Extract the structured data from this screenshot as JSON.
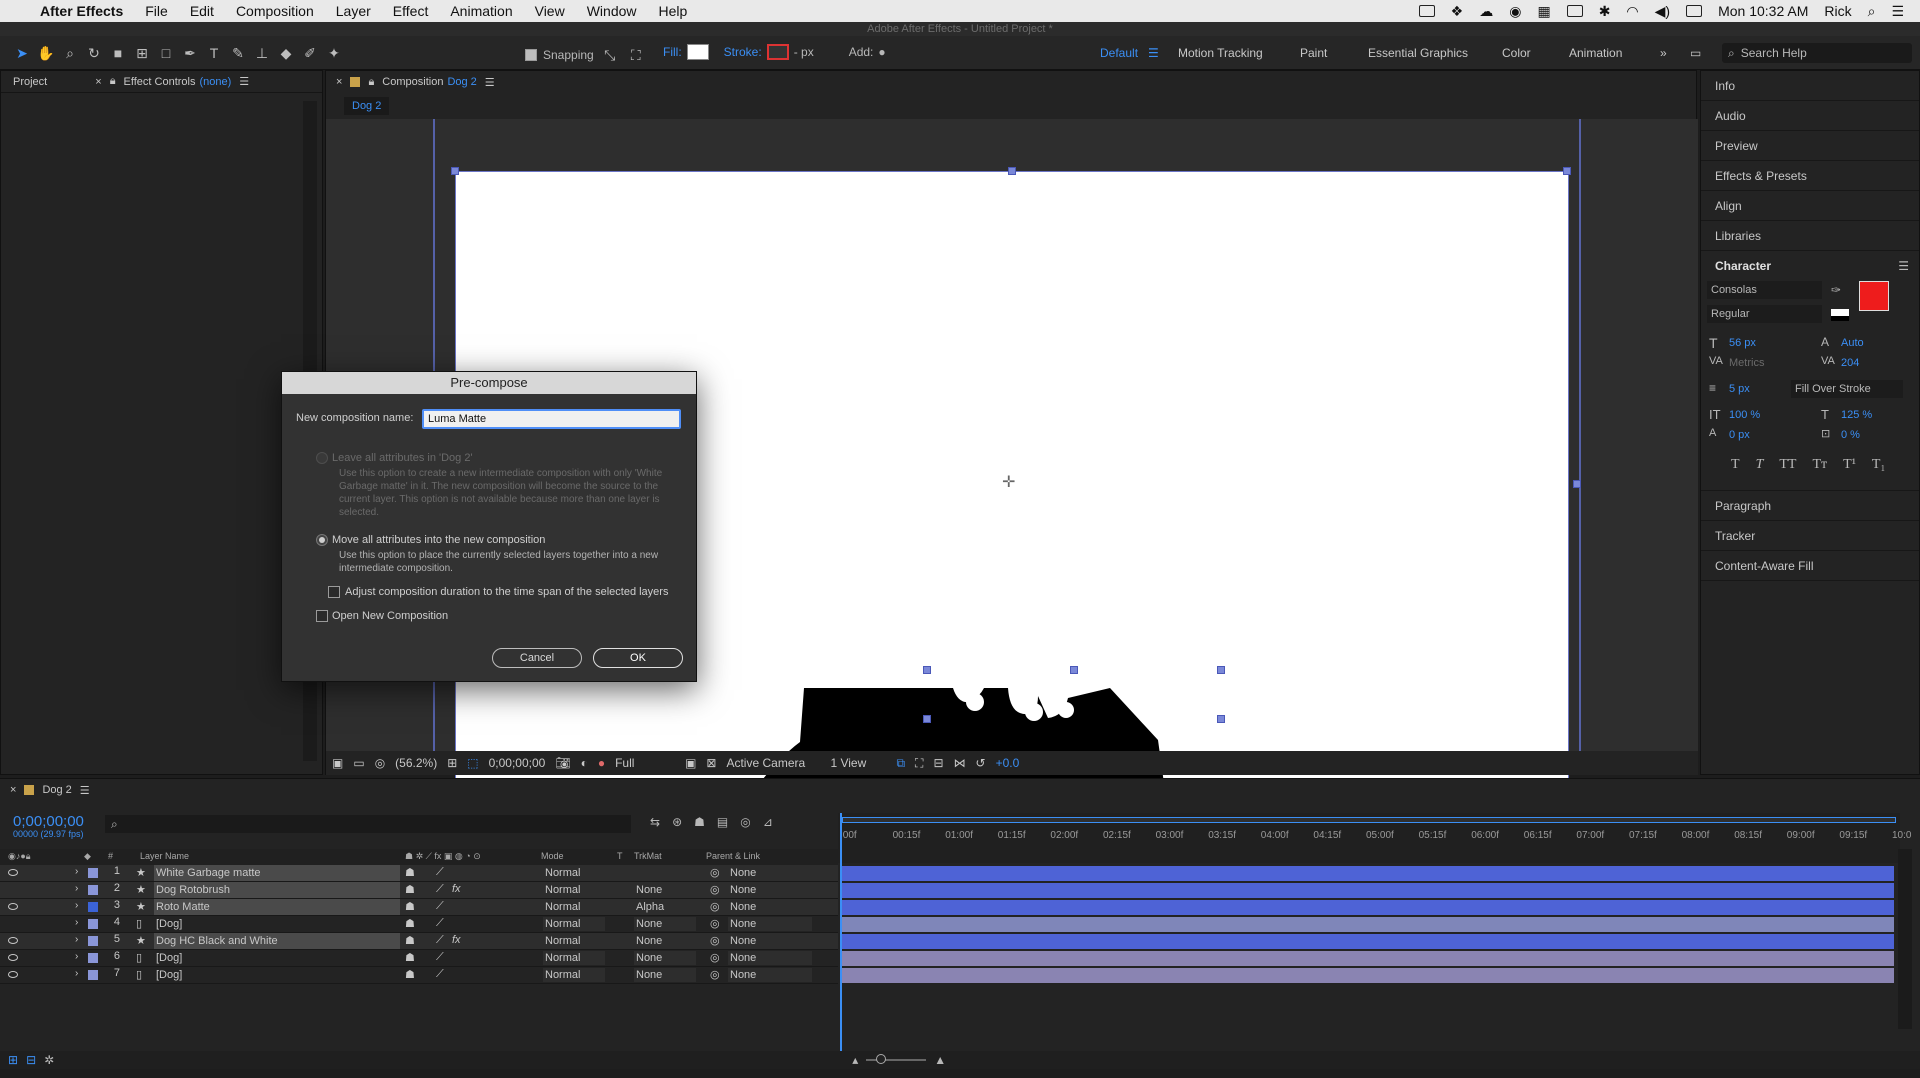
{
  "menubar": {
    "app": "After Effects",
    "items": [
      "File",
      "Edit",
      "Composition",
      "Layer",
      "Effect",
      "Animation",
      "View",
      "Window",
      "Help"
    ],
    "clock": "Mon 10:32 AM",
    "user": "Rick"
  },
  "window_title": "Adobe After Effects - Untitled Project *",
  "toolbar": {
    "snapping": "Snapping",
    "fill": "Fill:",
    "stroke": "Stroke:",
    "stroke_px": "- px",
    "add": "Add:",
    "workspaces": [
      "Default",
      "Motion Tracking",
      "Paint",
      "Essential Graphics",
      "Color",
      "Animation"
    ],
    "search_help": "Search Help"
  },
  "left_panel": {
    "tab_project": "Project",
    "tab_effect_controls": "Effect Controls",
    "effect_controls_target": "(none)"
  },
  "comp_panel": {
    "tab_label": "Composition",
    "comp_name": "Dog 2",
    "sub_tab": "Dog 2",
    "zoom": "(56.2%)",
    "timecode": "0;00;00;00",
    "resolution": "Full",
    "camera": "Active Camera",
    "views": "1 View",
    "exposure": "+0.0"
  },
  "right_panel": {
    "items": [
      "Info",
      "Audio",
      "Preview",
      "Effects & Presets",
      "Align",
      "Libraries"
    ],
    "character": {
      "title": "Character",
      "font": "Consolas",
      "style": "Regular",
      "size": "56 px",
      "leading": "Auto",
      "kerning": "Metrics",
      "tracking": "204",
      "stroke_width": "5 px",
      "stroke_mode": "Fill Over Stroke",
      "vscale": "100 %",
      "hscale": "125 %",
      "baseline": "0 px",
      "tsume": "0 %",
      "fill_color": "#ee1c1c"
    },
    "after": [
      "Paragraph",
      "Tracker",
      "Content-Aware Fill"
    ]
  },
  "dialog": {
    "title": "Pre-compose",
    "name_label": "New composition name:",
    "name_value": "Luma Matte",
    "opt1_label": "Leave all attributes in 'Dog 2'",
    "opt1_desc": [
      "Use this option to create a new intermediate composition with only 'White",
      "Garbage matte' in it. The new composition will become the source to the",
      "current layer. This option is not available because more than one layer is",
      "selected."
    ],
    "opt2_label": "Move all attributes into the new composition",
    "opt2_desc": [
      "Use this option to place the currently selected layers together into a new",
      "intermediate composition."
    ],
    "adjust_label": "Adjust composition duration to the time span of the selected layers",
    "open_label": "Open New Composition",
    "cancel": "Cancel",
    "ok": "OK"
  },
  "timeline": {
    "comp_tab": "Dog 2",
    "timecode": "0;00;00;00",
    "fps": "00000 (29.97 fps)",
    "headers": {
      "num": "#",
      "name": "Layer Name",
      "mode": "Mode",
      "t": "T",
      "trkmat": "TrkMat",
      "parent": "Parent & Link"
    },
    "ruler": [
      ":00f",
      "00:15f",
      "01:00f",
      "01:15f",
      "02:00f",
      "02:15f",
      "03:00f",
      "03:15f",
      "04:00f",
      "04:15f",
      "05:00f",
      "05:15f",
      "06:00f",
      "06:15f",
      "07:00f",
      "07:15f",
      "08:00f",
      "08:15f",
      "09:00f",
      "09:15f",
      "10:0"
    ],
    "layers": [
      {
        "num": "1",
        "name": "White Garbage matte",
        "mode": "Normal",
        "trkmat": "",
        "parent": "None",
        "color": "#8a96d8",
        "selected": true,
        "fx": false
      },
      {
        "num": "2",
        "name": "Dog Rotobrush",
        "mode": "Normal",
        "trkmat": "None",
        "parent": "None",
        "color": "#8a96d8",
        "selected": true,
        "fx": true
      },
      {
        "num": "3",
        "name": "Roto Matte",
        "mode": "Normal",
        "trkmat": "Alpha",
        "parent": "None",
        "color": "#3b63d6",
        "selected": true,
        "fx": false
      },
      {
        "num": "4",
        "name": "[Dog]",
        "mode": "Normal",
        "trkmat": "None",
        "parent": "None",
        "color": "#8a96d8",
        "selected": false,
        "fx": false
      },
      {
        "num": "5",
        "name": "Dog HC Black and White",
        "mode": "Normal",
        "trkmat": "None",
        "parent": "None",
        "color": "#8a96d8",
        "selected": true,
        "fx": true
      },
      {
        "num": "6",
        "name": "[Dog]",
        "mode": "Normal",
        "trkmat": "None",
        "parent": "None",
        "color": "#8a96d8",
        "selected": false,
        "fx": false
      },
      {
        "num": "7",
        "name": "[Dog]",
        "mode": "Normal",
        "trkmat": "None",
        "parent": "None",
        "color": "#8a96d8",
        "selected": false,
        "fx": false
      }
    ]
  }
}
